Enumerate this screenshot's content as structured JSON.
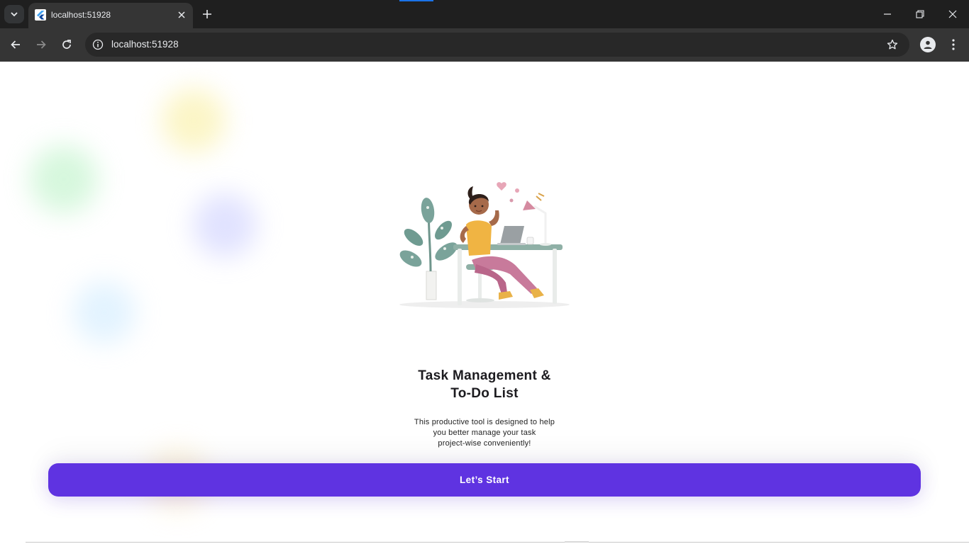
{
  "browser": {
    "tab": {
      "title": "localhost:51928"
    },
    "address_bar": {
      "url": "localhost:51928"
    }
  },
  "colors": {
    "accent": "#5f33e1",
    "chrome_dark": "#1f1f1f",
    "toolbar": "#353535"
  },
  "icons": {
    "tab_search": "chevron-down-icon",
    "favicon": "flutter-icon",
    "tab_close": "close-icon",
    "new_tab": "plus-icon",
    "back": "arrow-left-icon",
    "forward": "arrow-right-icon",
    "reload": "reload-icon",
    "site_info": "info-icon",
    "bookmark": "star-icon",
    "profile": "person-icon",
    "menu": "more-vert-icon"
  },
  "onboarding": {
    "title_line1": "Task Management &",
    "title_line2": "To-Do List",
    "description_line1": "This productive tool is designed to help",
    "description_line2": "you better manage your task",
    "description_line3": "project-wise conveniently!",
    "cta_label": "Let’s Start"
  }
}
